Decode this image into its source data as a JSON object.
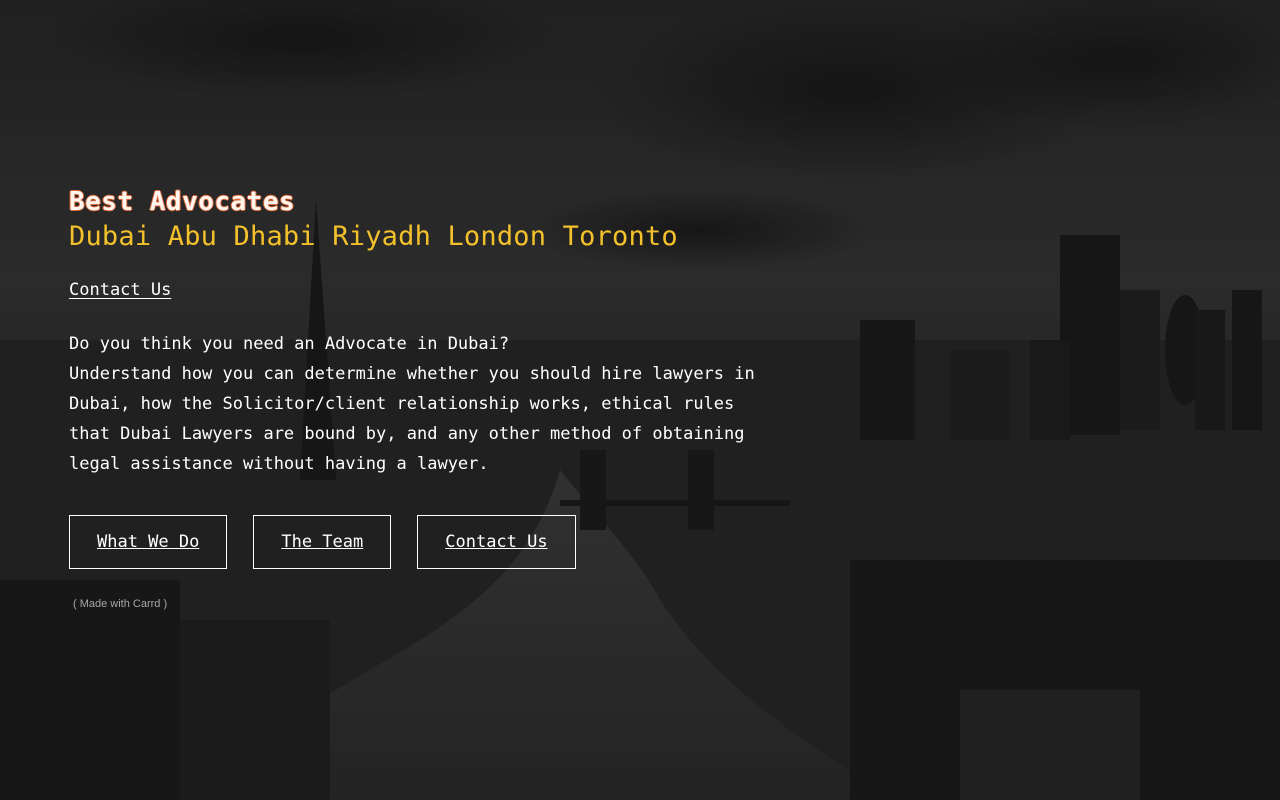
{
  "hero": {
    "title": "Best Advocates",
    "subtitle": "Dubai Abu Dhabi Riyadh London Toronto",
    "contact_link": "Contact Us",
    "paragraph_1": "Do you think you need an Advocate in Dubai?",
    "paragraph_2": "Understand how you can determine whether you should hire lawyers in Dubai, how the Solicitor/client relationship works, ethical rules that Dubai Lawyers are bound by, and any other method of obtaining legal assistance without having a lawyer."
  },
  "buttons": [
    {
      "label": "What We Do"
    },
    {
      "label": "The Team"
    },
    {
      "label": "Contact Us"
    }
  ],
  "credit": "( Made with Carrd )",
  "colors": {
    "title_outline": "#e06a3c",
    "subtitle": "#f3c12b",
    "text": "#ffffff",
    "background": "#1f1f1f"
  }
}
